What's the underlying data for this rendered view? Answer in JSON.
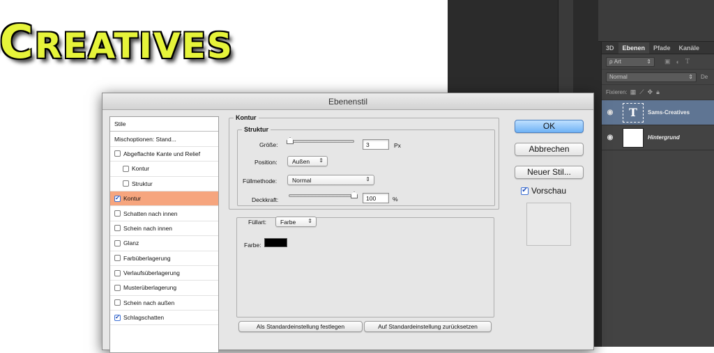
{
  "canvas": {
    "headline_prefix": "-C",
    "headline_rest": "REATIVES"
  },
  "layers_panel": {
    "tabs": [
      "3D",
      "Ebenen",
      "Pfade",
      "Kanäle"
    ],
    "filter": {
      "label": "ρ Art"
    },
    "blend_mode": "Normal",
    "opacity_label": "De",
    "lock_label": "Fixieren:",
    "layers": [
      {
        "name": "Sams-Creatives",
        "thumb": "T",
        "selected": true
      },
      {
        "name": "Hintergrund",
        "thumb": "",
        "selected": false
      }
    ]
  },
  "dialog": {
    "title": "Ebenenstil",
    "styles_header": "Stile",
    "styles": [
      {
        "label": "Mischoptionen: Stand...",
        "checkbox": false,
        "checked": false,
        "indent": false,
        "selected": false
      },
      {
        "label": "Abgeflachte Kante und Relief",
        "checkbox": true,
        "checked": false,
        "indent": false,
        "selected": false
      },
      {
        "label": "Kontur",
        "checkbox": true,
        "checked": false,
        "indent": true,
        "selected": false
      },
      {
        "label": "Struktur",
        "checkbox": true,
        "checked": false,
        "indent": true,
        "selected": false
      },
      {
        "label": "Kontur",
        "checkbox": true,
        "checked": true,
        "indent": false,
        "selected": true
      },
      {
        "label": "Schatten nach innen",
        "checkbox": true,
        "checked": false,
        "indent": false,
        "selected": false
      },
      {
        "label": "Schein nach innen",
        "checkbox": true,
        "checked": false,
        "indent": false,
        "selected": false
      },
      {
        "label": "Glanz",
        "checkbox": true,
        "checked": false,
        "indent": false,
        "selected": false
      },
      {
        "label": "Farbüberlagerung",
        "checkbox": true,
        "checked": false,
        "indent": false,
        "selected": false
      },
      {
        "label": "Verlaufsüberlagerung",
        "checkbox": true,
        "checked": false,
        "indent": false,
        "selected": false
      },
      {
        "label": "Musterüberlagerung",
        "checkbox": true,
        "checked": false,
        "indent": false,
        "selected": false
      },
      {
        "label": "Schein nach außen",
        "checkbox": true,
        "checked": false,
        "indent": false,
        "selected": false
      },
      {
        "label": "Schlagschatten",
        "checkbox": true,
        "checked": true,
        "indent": false,
        "selected": false
      }
    ],
    "kontur": {
      "legend": "Kontur",
      "struktur_legend": "Struktur",
      "size_label": "Größe:",
      "size_value": "3",
      "size_unit": "Px",
      "position_label": "Position:",
      "position_value": "Außen",
      "fill_method_label": "Füllmethode:",
      "fill_method_value": "Normal",
      "opacity_label": "Deckkraft:",
      "opacity_value": "100",
      "opacity_unit": "%",
      "fill_type_label": "Füllart:",
      "fill_type_value": "Farbe",
      "color_label": "Farbe:",
      "color_value": "#000000"
    },
    "bottom_buttons": {
      "set_default": "Als Standardeinstellung festlegen",
      "reset_default": "Auf Standardeinstellung zurücksetzen"
    },
    "buttons": {
      "ok": "OK",
      "cancel": "Abbrechen",
      "new_style": "Neuer Stil..."
    },
    "preview_label": "Vorschau",
    "preview_checked": true
  }
}
